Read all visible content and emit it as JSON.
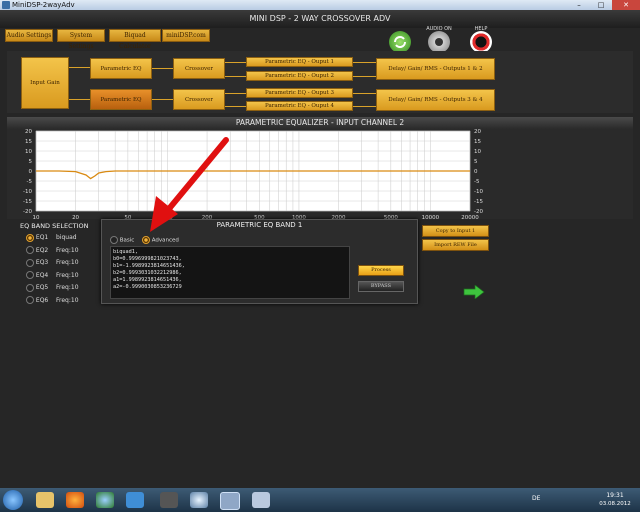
{
  "window": {
    "title": "MiniDSP-2wayAdv",
    "minimize": "–",
    "maximize": "□",
    "close": "✕"
  },
  "app": {
    "title": "MINI DSP - 2 WAY CROSSOVER ADV"
  },
  "menu": [
    "Audio Settings",
    "System Settings",
    "Biquad Calculator",
    "miniDSP.com"
  ],
  "top_icons": [
    {
      "label": ""
    },
    {
      "label": "AUDIO ON"
    },
    {
      "label": "HELP"
    }
  ],
  "routing": {
    "input_gain": "Input Gain",
    "peq": [
      "Parametric EQ",
      "Parametric EQ"
    ],
    "crossover": [
      "Crossover",
      "Crossover"
    ],
    "outputs_peq": [
      "Parametric EQ - Ouput 1",
      "Parametric EQ - Ouput 2",
      "Parametric EQ - Ouput 3",
      "Parametric EQ - Ouput 4"
    ],
    "delay": [
      "Delay/ Gain/ RMS - Outputs 1 & 2",
      "Delay/ Gain/ RMS - Outputs 3 & 4"
    ]
  },
  "peq_section": {
    "title": "PARAMETRIC EQUALIZER - INPUT CHANNEL 2"
  },
  "chart_data": {
    "type": "line",
    "title": "",
    "xlabel": "",
    "ylabel": "",
    "x_scale": "log",
    "xlim": [
      10,
      20000
    ],
    "ylim": [
      -20,
      20
    ],
    "x_ticks": [
      "10",
      "20",
      "50",
      "100",
      "200",
      "500",
      "1000",
      "2000",
      "5000",
      "10000",
      "20000"
    ],
    "y_ticks": [
      "20",
      "15",
      "10",
      "5",
      "0",
      "-5",
      "-10",
      "-15",
      "-20"
    ],
    "grid": true,
    "series": [
      {
        "x": [
          10,
          15,
          20,
          24,
          26,
          28,
          30,
          34,
          40,
          60,
          100,
          1000,
          20000
        ],
        "y": [
          0,
          0,
          -0.3,
          -2,
          -3.8,
          -2.5,
          -1,
          -0.3,
          0,
          0,
          0,
          0,
          0
        ]
      }
    ]
  },
  "eq_band": {
    "title": "EQ BAND SELECTION",
    "items": [
      {
        "label": "EQ1",
        "value": "biquad",
        "selected": true
      },
      {
        "label": "EQ2",
        "value": "Freq:10",
        "selected": false
      },
      {
        "label": "EQ3",
        "value": "Freq:10",
        "selected": false
      },
      {
        "label": "EQ4",
        "value": "Freq:10",
        "selected": false
      },
      {
        "label": "EQ5",
        "value": "Freq:10",
        "selected": false
      },
      {
        "label": "EQ6",
        "value": "Freq:10",
        "selected": false
      }
    ]
  },
  "dialog": {
    "title": "PARAMETRIC EQ BAND 1",
    "mode_basic": "Basic",
    "mode_advanced": "Advanced",
    "coefficients": [
      "biquad1,",
      "b0=0.9996999821023743,",
      "b1=-1.9989923814651436,",
      "b2=0.9993031032212986,",
      "a1=1.9989923814651436,",
      "a2=-0.9990030853236729"
    ],
    "process": "Process",
    "bypass": "BYPASS"
  },
  "right_buttons": [
    "Copy to Input 1",
    "Import REW File"
  ],
  "colors": {
    "accent": "#e1a02e",
    "curve": "#d98a12",
    "arrow": "#e01010",
    "next_arrow": "#3ec43e"
  },
  "taskbar": {
    "lang": "DE",
    "time": "19:31",
    "date": "03.08.2012"
  }
}
